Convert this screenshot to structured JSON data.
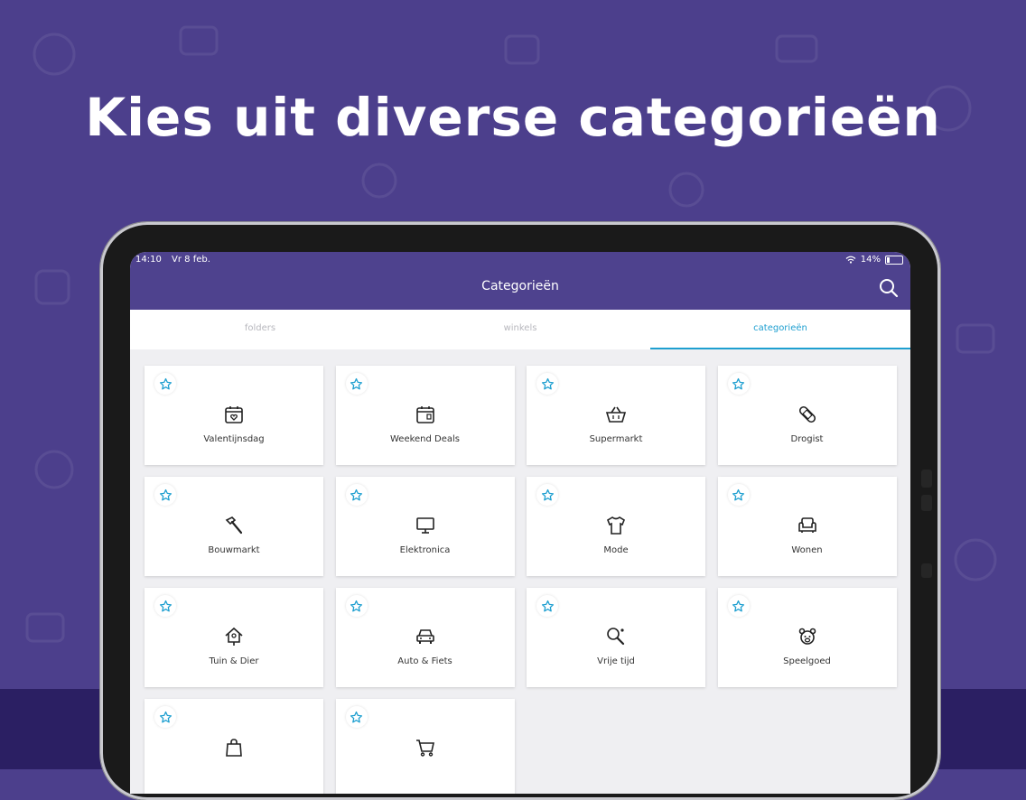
{
  "headline": "Kies uit diverse categorieën",
  "status": {
    "time": "14:10",
    "date": "Vr 8 feb.",
    "battery": "14%"
  },
  "navbar": {
    "title": "Categorieën"
  },
  "tabs": [
    {
      "label": "folders",
      "active": false
    },
    {
      "label": "winkels",
      "active": false
    },
    {
      "label": "categorieën",
      "active": true
    }
  ],
  "categories": [
    {
      "label": "Valentijnsdag",
      "icon": "calendar-heart-icon"
    },
    {
      "label": "Weekend Deals",
      "icon": "calendar-icon"
    },
    {
      "label": "Supermarkt",
      "icon": "basket-icon"
    },
    {
      "label": "Drogist",
      "icon": "bandage-icon"
    },
    {
      "label": "Bouwmarkt",
      "icon": "hammer-icon"
    },
    {
      "label": "Elektronica",
      "icon": "monitor-icon"
    },
    {
      "label": "Mode",
      "icon": "shirt-icon"
    },
    {
      "label": "Wonen",
      "icon": "armchair-icon"
    },
    {
      "label": "Tuin & Dier",
      "icon": "birdhouse-icon"
    },
    {
      "label": "Auto & Fiets",
      "icon": "car-icon"
    },
    {
      "label": "Vrije tijd",
      "icon": "racket-icon"
    },
    {
      "label": "Speelgoed",
      "icon": "teddy-bear-icon"
    },
    {
      "label": "",
      "icon": "shopping-bag-icon"
    },
    {
      "label": "",
      "icon": "shopping-cart-icon"
    }
  ],
  "colors": {
    "brand": "#4e428e",
    "accent": "#1e9fd0",
    "background_dark": "#2b1f63"
  }
}
